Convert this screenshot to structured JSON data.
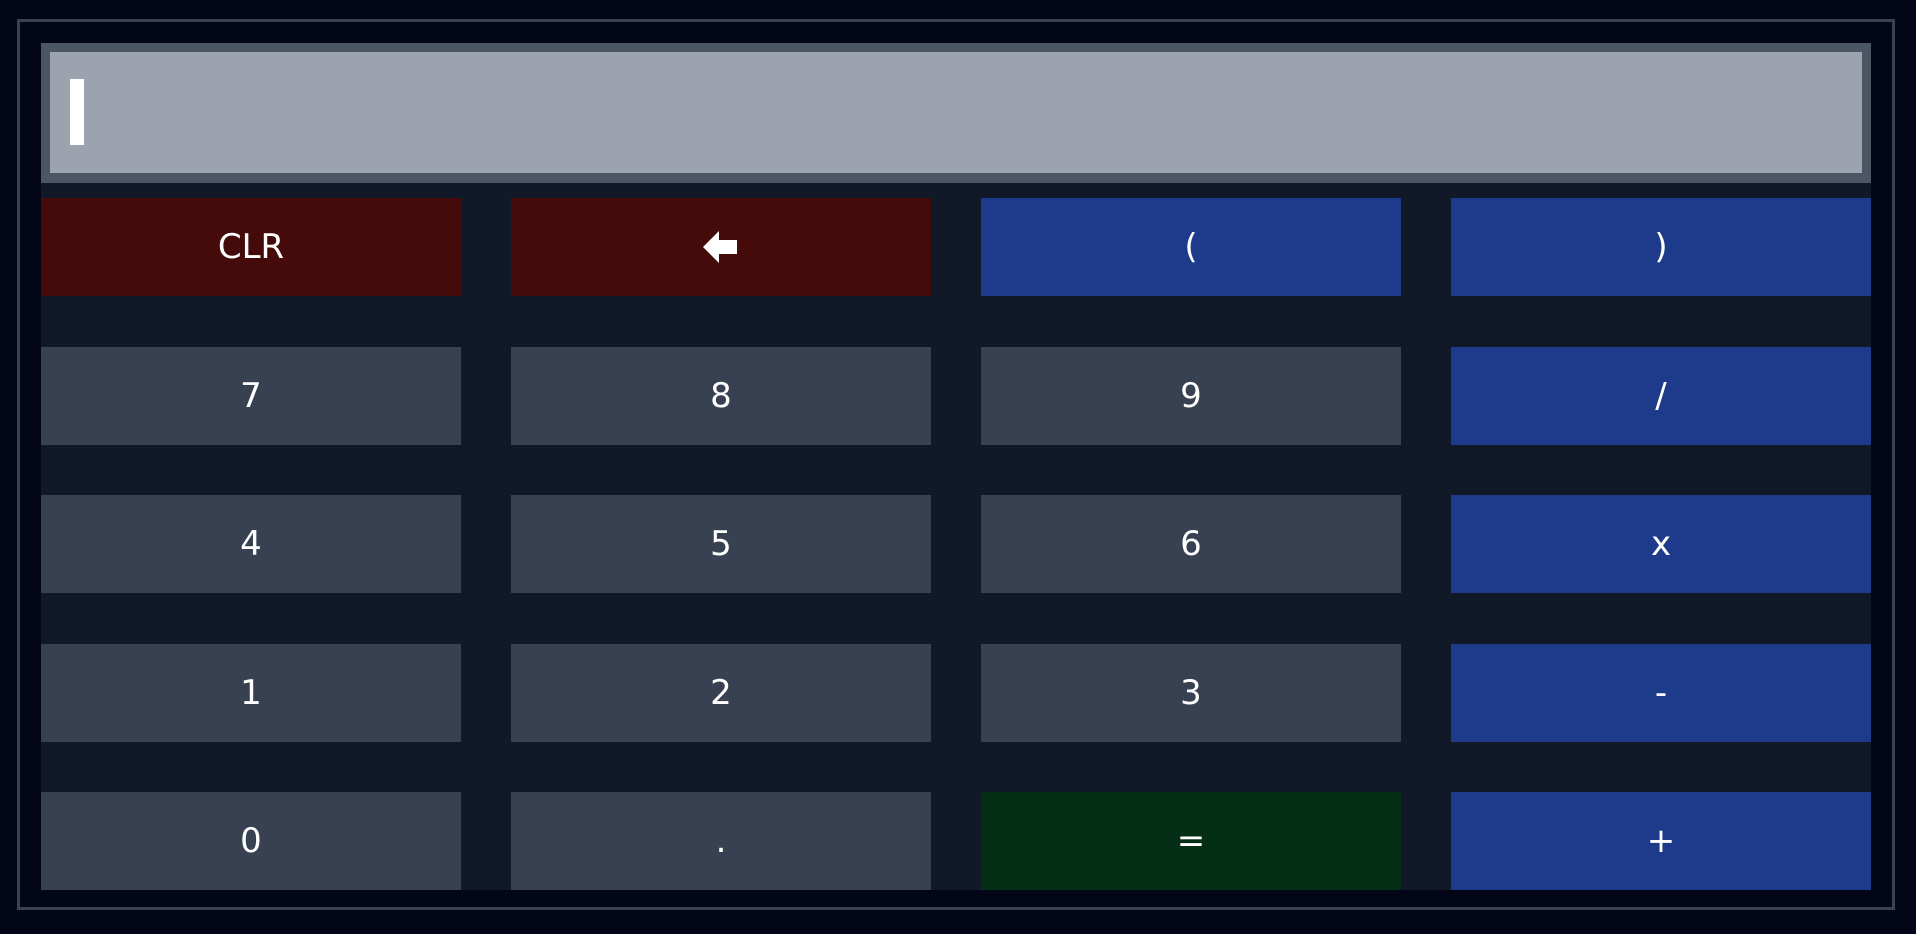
{
  "display": {
    "value": ""
  },
  "keys": {
    "clr": "CLR",
    "backspace_icon": "backspace-arrow-icon",
    "lparen": "(",
    "rparen": ")",
    "seven": "7",
    "eight": "8",
    "nine": "9",
    "divide": "/",
    "four": "4",
    "five": "5",
    "six": "6",
    "multiply": "x",
    "one": "1",
    "two": "2",
    "three": "3",
    "minus": "-",
    "zero": "0",
    "dot": ".",
    "equals": "=",
    "plus": "+"
  },
  "colors": {
    "background": "#020617",
    "panel": "#111827",
    "display_border": "#4b5563",
    "display": "#9ca3af",
    "number_key": "#374151",
    "operator_key": "#1e3a8a",
    "danger_key": "#450a0a",
    "equals_key": "#052e16",
    "text": "#ffffff"
  }
}
